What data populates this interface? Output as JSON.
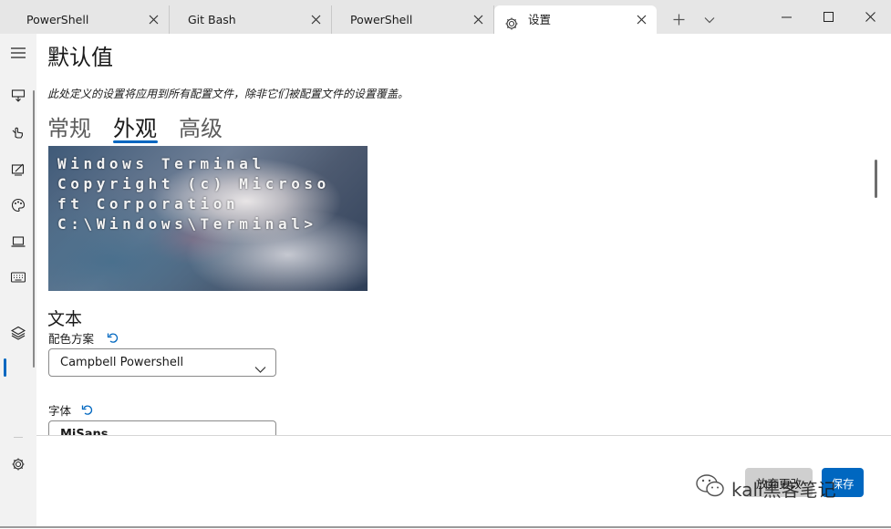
{
  "tabs": [
    {
      "label": "PowerShell"
    },
    {
      "label": "Git Bash"
    },
    {
      "label": "PowerShell"
    },
    {
      "label": "设置"
    }
  ],
  "page": {
    "title": "默认值",
    "description": "此处定义的设置将应用到所有配置文件，除非它们被配置文件的设置覆盖。"
  },
  "subtabs": [
    "常规",
    "外观",
    "高级"
  ],
  "selected_subtab": "外观",
  "preview": {
    "lines": [
      "Windows Terminal",
      "Copyright (c) Microso",
      "ft Corporation",
      "C:\\Windows\\Terminal>"
    ]
  },
  "text_section": {
    "heading": "文本",
    "color_scheme_label": "配色方案",
    "color_scheme_value": "Campbell Powershell",
    "font_label": "字体",
    "font_value": "MiSans"
  },
  "actions": {
    "discard_label": "放弃更改",
    "save_label": "保存"
  },
  "watermark": {
    "text": "kali黑客笔记"
  },
  "colors": {
    "accent": "#0067c0",
    "tabbar_bg": "#e6e6e6",
    "rail_bg": "#f2f2f2"
  },
  "icons": {
    "rail": [
      "menu-icon",
      "startup-icon",
      "interaction-icon",
      "appearance-icon",
      "color-schemes-icon",
      "rendering-icon",
      "actions-icon",
      "defaults-layers-icon",
      "settings-gear-icon"
    ],
    "tabbar": [
      "close-icon",
      "gear-icon",
      "new-tab-plus-icon",
      "dropdown-chevron-icon",
      "minimize-icon",
      "maximize-icon",
      "window-close-icon"
    ]
  }
}
